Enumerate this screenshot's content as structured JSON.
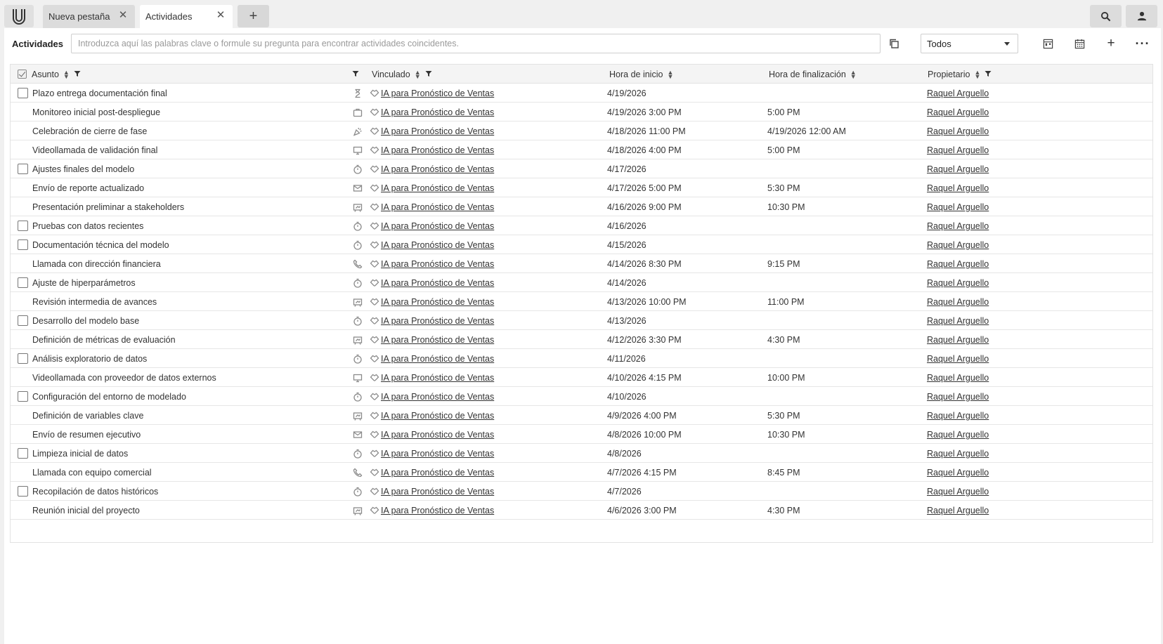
{
  "tabs": [
    {
      "label": "Nueva pestaña"
    },
    {
      "label": "Actividades"
    }
  ],
  "toolbar": {
    "title": "Actividades",
    "search_placeholder": "Introduzca aquí las palabras clave o formule su pregunta para encontrar actividades coincidentes.",
    "filter_value": "Todos"
  },
  "columns": {
    "subject": "Asunto",
    "linked": "Vinculado",
    "start": "Hora de inicio",
    "end": "Hora de finalización",
    "owner": "Propietario"
  },
  "icons": {
    "task": "clock-icon",
    "deadline": "hourglass-icon",
    "meeting": "presentation-icon",
    "event": "briefcase-icon",
    "celebration": "party-popper-icon",
    "video": "monitor-icon",
    "email": "envelope-icon",
    "call": "phone-icon",
    "linked": "deal-handshake-icon"
  },
  "rows": [
    {
      "checkbox": true,
      "subject": "Plazo entrega documentación final",
      "type": "deadline",
      "linked": "IA para Pronóstico de Ventas",
      "start": "4/19/2026",
      "end": "",
      "owner": "Raquel Arguello"
    },
    {
      "checkbox": false,
      "subject": "Monitoreo inicial post-despliegue",
      "type": "event",
      "linked": "IA para Pronóstico de Ventas",
      "start": "4/19/2026 3:00 PM",
      "end": "5:00 PM",
      "owner": "Raquel Arguello"
    },
    {
      "checkbox": false,
      "subject": "Celebración de cierre de fase",
      "type": "celebration",
      "linked": "IA para Pronóstico de Ventas",
      "start": "4/18/2026 11:00 PM",
      "end": "4/19/2026 12:00 AM",
      "owner": "Raquel Arguello"
    },
    {
      "checkbox": false,
      "subject": "Videollamada de validación final",
      "type": "video",
      "linked": "IA para Pronóstico de Ventas",
      "start": "4/18/2026 4:00 PM",
      "end": "5:00 PM",
      "owner": "Raquel Arguello"
    },
    {
      "checkbox": true,
      "subject": "Ajustes finales del modelo",
      "type": "task",
      "linked": "IA para Pronóstico de Ventas",
      "start": "4/17/2026",
      "end": "",
      "owner": "Raquel Arguello"
    },
    {
      "checkbox": false,
      "subject": "Envío de reporte actualizado",
      "type": "email",
      "linked": "IA para Pronóstico de Ventas",
      "start": "4/17/2026 5:00 PM",
      "end": "5:30 PM",
      "owner": "Raquel Arguello"
    },
    {
      "checkbox": false,
      "subject": "Presentación preliminar a stakeholders",
      "type": "meeting",
      "linked": "IA para Pronóstico de Ventas",
      "start": "4/16/2026 9:00 PM",
      "end": "10:30 PM",
      "owner": "Raquel Arguello"
    },
    {
      "checkbox": true,
      "subject": "Pruebas con datos recientes",
      "type": "task",
      "linked": "IA para Pronóstico de Ventas",
      "start": "4/16/2026",
      "end": "",
      "owner": "Raquel Arguello"
    },
    {
      "checkbox": true,
      "subject": "Documentación técnica del modelo",
      "type": "task",
      "linked": "IA para Pronóstico de Ventas",
      "start": "4/15/2026",
      "end": "",
      "owner": "Raquel Arguello"
    },
    {
      "checkbox": false,
      "subject": "Llamada con dirección financiera",
      "type": "call",
      "linked": "IA para Pronóstico de Ventas",
      "start": "4/14/2026 8:30 PM",
      "end": "9:15 PM",
      "owner": "Raquel Arguello"
    },
    {
      "checkbox": true,
      "subject": "Ajuste de hiperparámetros",
      "type": "task",
      "linked": "IA para Pronóstico de Ventas",
      "start": "4/14/2026",
      "end": "",
      "owner": "Raquel Arguello"
    },
    {
      "checkbox": false,
      "subject": "Revisión intermedia de avances",
      "type": "meeting",
      "linked": "IA para Pronóstico de Ventas",
      "start": "4/13/2026 10:00 PM",
      "end": "11:00 PM",
      "owner": "Raquel Arguello"
    },
    {
      "checkbox": true,
      "subject": "Desarrollo del modelo base",
      "type": "task",
      "linked": "IA para Pronóstico de Ventas",
      "start": "4/13/2026",
      "end": "",
      "owner": "Raquel Arguello"
    },
    {
      "checkbox": false,
      "subject": "Definición de métricas de evaluación",
      "type": "meeting",
      "linked": "IA para Pronóstico de Ventas",
      "start": "4/12/2026 3:30 PM",
      "end": "4:30 PM",
      "owner": "Raquel Arguello"
    },
    {
      "checkbox": true,
      "subject": "Análisis exploratorio de datos",
      "type": "task",
      "linked": "IA para Pronóstico de Ventas",
      "start": "4/11/2026",
      "end": "",
      "owner": "Raquel Arguello"
    },
    {
      "checkbox": false,
      "subject": "Videollamada con proveedor de datos externos",
      "type": "video",
      "linked": "IA para Pronóstico de Ventas",
      "start": "4/10/2026 4:15 PM",
      "end": "10:00 PM",
      "owner": "Raquel Arguello"
    },
    {
      "checkbox": true,
      "subject": "Configuración del entorno de modelado",
      "type": "task",
      "linked": "IA para Pronóstico de Ventas",
      "start": "4/10/2026",
      "end": "",
      "owner": "Raquel Arguello"
    },
    {
      "checkbox": false,
      "subject": "Definición de variables clave",
      "type": "meeting",
      "linked": "IA para Pronóstico de Ventas",
      "start": "4/9/2026 4:00 PM",
      "end": "5:30 PM",
      "owner": "Raquel Arguello"
    },
    {
      "checkbox": false,
      "subject": "Envío de resumen ejecutivo",
      "type": "email",
      "linked": "IA para Pronóstico de Ventas",
      "start": "4/8/2026 10:00 PM",
      "end": "10:30 PM",
      "owner": "Raquel Arguello"
    },
    {
      "checkbox": true,
      "subject": "Limpieza inicial de datos",
      "type": "task",
      "linked": "IA para Pronóstico de Ventas",
      "start": "4/8/2026",
      "end": "",
      "owner": "Raquel Arguello"
    },
    {
      "checkbox": false,
      "subject": "Llamada con equipo comercial",
      "type": "call",
      "linked": "IA para Pronóstico de Ventas",
      "start": "4/7/2026 4:15 PM",
      "end": "8:45 PM",
      "owner": "Raquel Arguello"
    },
    {
      "checkbox": true,
      "subject": "Recopilación de datos históricos",
      "type": "task",
      "linked": "IA para Pronóstico de Ventas",
      "start": "4/7/2026",
      "end": "",
      "owner": "Raquel Arguello"
    },
    {
      "checkbox": false,
      "subject": "Reunión inicial del proyecto",
      "type": "meeting",
      "linked": "IA para Pronóstico de Ventas",
      "start": "4/6/2026 3:00 PM",
      "end": "4:30 PM",
      "owner": "Raquel Arguello"
    }
  ]
}
